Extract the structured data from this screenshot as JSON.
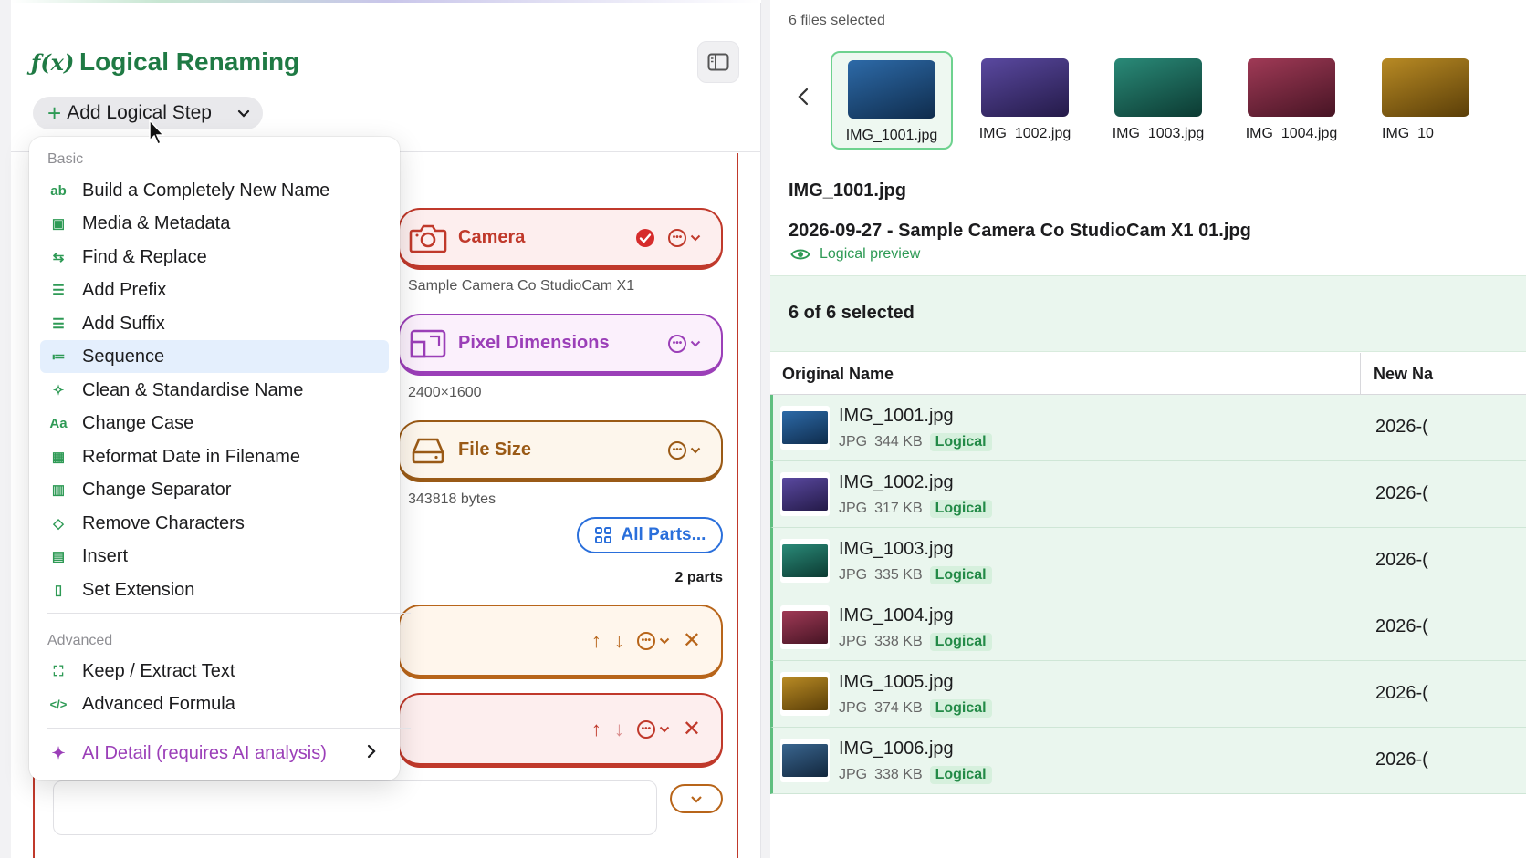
{
  "left": {
    "title_symbol": "ƒ(x)",
    "title": "Logical Renaming",
    "add_step_label": "Add Logical Step",
    "cards": [
      {
        "title": "Camera",
        "sub": "Sample Camera Co StudioCam X1",
        "color": "#c0392b",
        "bg": "#fdeeee"
      },
      {
        "title": "Pixel Dimensions",
        "sub": "2400×1600",
        "color": "#9b3fb8",
        "bg": "#fbf0fc"
      },
      {
        "title": "File Size",
        "sub": "343818 bytes",
        "color": "#9a5a16",
        "bg": "#fdf6ec"
      }
    ],
    "all_parts_label": "All Parts...",
    "parts_count": "2 parts"
  },
  "menu": {
    "basic_label": "Basic",
    "advanced_label": "Advanced",
    "items": [
      {
        "label": "Build a Completely New Name",
        "icon": "ab"
      },
      {
        "label": "Media & Metadata",
        "icon": "▣"
      },
      {
        "label": "Find & Replace",
        "icon": "⇆"
      },
      {
        "label": "Add Prefix",
        "icon": "☰"
      },
      {
        "label": "Add Suffix",
        "icon": "☰"
      },
      {
        "label": "Sequence",
        "icon": "≔"
      },
      {
        "label": "Clean & Standardise Name",
        "icon": "✧"
      },
      {
        "label": "Change Case",
        "icon": "Aa"
      },
      {
        "label": "Reformat Date in Filename",
        "icon": "▦"
      },
      {
        "label": "Change Separator",
        "icon": "▥"
      },
      {
        "label": "Remove Characters",
        "icon": "◇"
      },
      {
        "label": "Insert",
        "icon": "▤"
      },
      {
        "label": "Set Extension",
        "icon": "▯"
      }
    ],
    "advanced_items": [
      {
        "label": "Keep / Extract Text",
        "icon": "⛶"
      },
      {
        "label": "Advanced Formula",
        "icon": "</>"
      }
    ],
    "ai_item": {
      "label": "AI Detail (requires AI analysis)",
      "icon": "✦"
    }
  },
  "right": {
    "files_selected": "6 files selected",
    "thumbs": [
      {
        "name": "IMG_1001.jpg",
        "color": "#1b4a7a"
      },
      {
        "name": "IMG_1002.jpg",
        "color": "#3a2e6a"
      },
      {
        "name": "IMG_1003.jpg",
        "color": "#17584e"
      },
      {
        "name": "IMG_1004.jpg",
        "color": "#6a2438"
      },
      {
        "name": "IMG_10",
        "color": "#7a5a12"
      }
    ],
    "preview_original": "IMG_1001.jpg",
    "preview_new": "2026-09-27 - Sample Camera Co StudioCam X1 01.jpg",
    "preview_label": "Logical preview",
    "selected_count": "6 of 6 selected",
    "col_original": "Original Name",
    "col_new": "New Na",
    "rows": [
      {
        "name": "IMG_1001.jpg",
        "type": "JPG",
        "size": "344 KB",
        "badge": "Logical",
        "new": "2026-(",
        "color": "#1b4a7a"
      },
      {
        "name": "IMG_1002.jpg",
        "type": "JPG",
        "size": "317 KB",
        "badge": "Logical",
        "new": "2026-(",
        "color": "#3a2e6a"
      },
      {
        "name": "IMG_1003.jpg",
        "type": "JPG",
        "size": "335 KB",
        "badge": "Logical",
        "new": "2026-(",
        "color": "#17584e"
      },
      {
        "name": "IMG_1004.jpg",
        "type": "JPG",
        "size": "338 KB",
        "badge": "Logical",
        "new": "2026-(",
        "color": "#6a2438"
      },
      {
        "name": "IMG_1005.jpg",
        "type": "JPG",
        "size": "374 KB",
        "badge": "Logical",
        "new": "2026-(",
        "color": "#7a5a12"
      },
      {
        "name": "IMG_1006.jpg",
        "type": "JPG",
        "size": "338 KB",
        "badge": "Logical",
        "new": "2026-(",
        "color": "#22405e"
      }
    ]
  }
}
